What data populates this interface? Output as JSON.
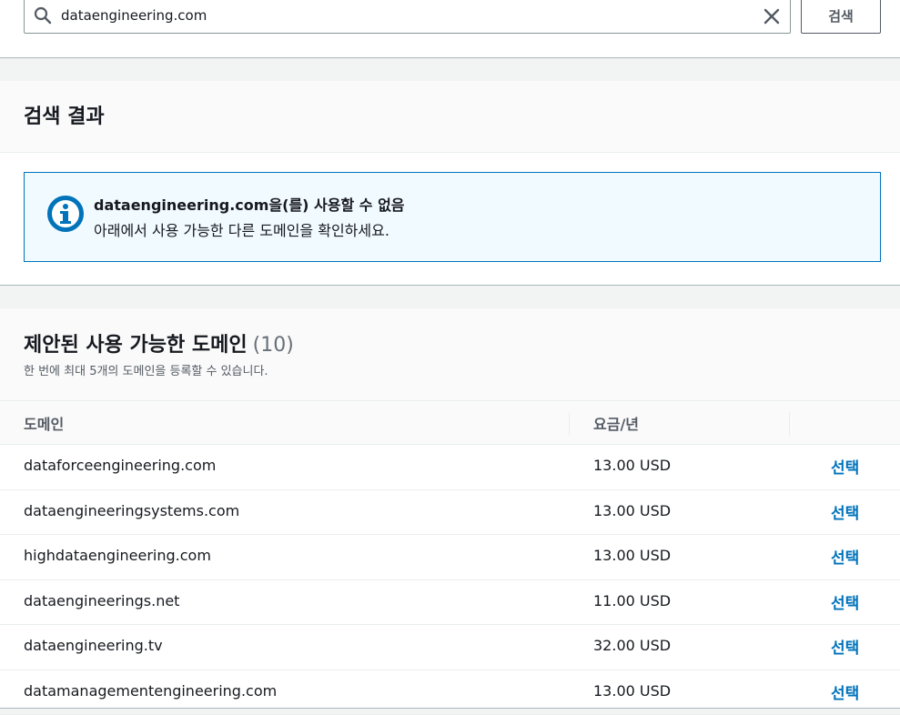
{
  "search": {
    "value": "dataengineering.com",
    "button_label": "검색"
  },
  "results": {
    "title": "검색 결과",
    "alert_title": "dataengineering.com을(를) 사용할 수 없음",
    "alert_body": "아래에서 사용 가능한 다른 도메인을 확인하세요."
  },
  "suggestions": {
    "title": "제안된 사용 가능한 도메인",
    "count": "(10)",
    "description": "한 번에 최대 5개의 도메인을 등록할 수 있습니다.",
    "columns": {
      "domain": "도메인",
      "price": "요금/년"
    },
    "rows": [
      {
        "domain": "dataforceengineering.com",
        "price": "13.00 USD",
        "action": "선택"
      },
      {
        "domain": "dataengineeringsystems.com",
        "price": "13.00 USD",
        "action": "선택"
      },
      {
        "domain": "highdataengineering.com",
        "price": "13.00 USD",
        "action": "선택"
      },
      {
        "domain": "dataengineerings.net",
        "price": "11.00 USD",
        "action": "선택"
      },
      {
        "domain": "dataengineering.tv",
        "price": "32.00 USD",
        "action": "선택"
      },
      {
        "domain": "datamanagementengineering.com",
        "price": "13.00 USD",
        "action": "선택"
      }
    ]
  },
  "colors": {
    "accent": "#0073bb",
    "border": "#aab7b8"
  },
  "icons": {
    "search": "search-icon",
    "clear": "close-icon",
    "info": "info-icon"
  }
}
